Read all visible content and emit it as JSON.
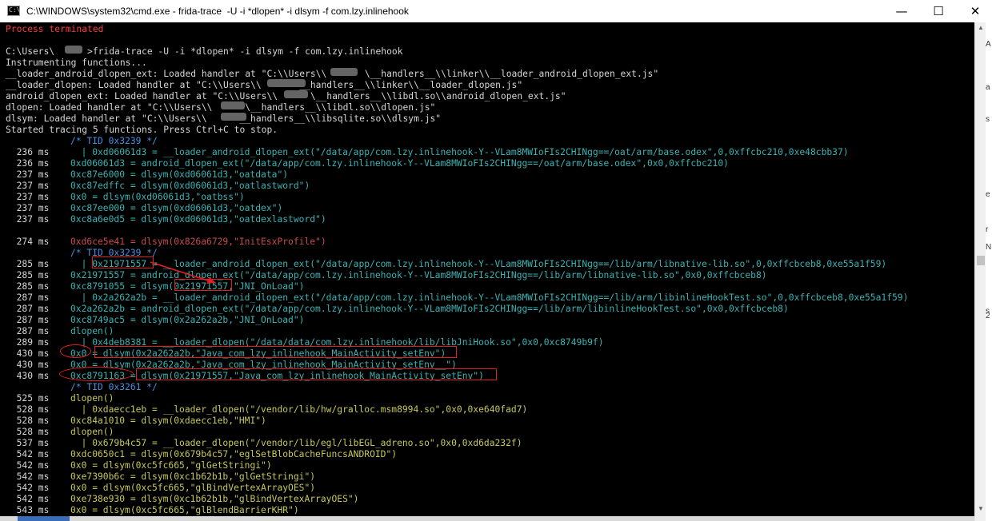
{
  "window": {
    "title": "C:\\WINDOWS\\system32\\cmd.exe - frida-trace  -U -i *dlopen* -i dlsym -f com.lzy.inlinehook",
    "minimize_glyph": "—",
    "maximize_glyph": "☐",
    "close_glyph": "✕",
    "icon_text": "C:\\"
  },
  "colors": {
    "console_bg": "#000000",
    "default_text": "#d6d6d6",
    "process_terminated": "#ff3b3b",
    "tid_comment": "#4a8fe0",
    "trace_pid_3239": "#3ab3b3",
    "trace_pid_325f": "#c94c4c",
    "trace_pid_3261": "#c8c85a",
    "highlight_box": "#e02020"
  },
  "console": {
    "lines": [
      {
        "text": "Process terminated",
        "color": "process_terminated"
      },
      {
        "text": "",
        "color": "default_text"
      },
      {
        "text": "C:\\Users\\      >frida-trace -U -i *dlopen* -i dlsym -f com.lzy.inlinehook",
        "color": "default_text"
      },
      {
        "text": "Instrumenting functions...",
        "color": "default_text"
      },
      {
        "text": "__loader_android_dlopen_ext: Loaded handler at \"C:\\\\Users\\\\       \\__handlers__\\\\linker\\\\__loader_android_dlopen_ext.js\"",
        "color": "default_text"
      },
      {
        "text": "__loader_dlopen: Loaded handler at \"C:\\\\Users\\\\       __handlers__\\\\linker\\\\__loader_dlopen.js\"",
        "color": "default_text"
      },
      {
        "text": "android_dlopen_ext: Loaded handler at \"C:\\\\Users\\\\      \\__handlers__\\\\libdl.so\\\\android_dlopen_ext.js\"",
        "color": "default_text"
      },
      {
        "text": "dlopen: Loaded handler at \"C:\\\\Users\\\\      \\__handlers__\\\\libdl.so\\\\dlopen.js\"",
        "color": "default_text"
      },
      {
        "text": "dlsym: Loaded handler at \"C:\\\\Users\\\\      __handlers__\\\\libsqlite.so\\\\dlsym.js\"",
        "color": "default_text"
      },
      {
        "text": "Started tracing 5 functions. Press Ctrl+C to stop.",
        "color": "default_text"
      },
      {
        "ms": "",
        "text": "/* TID 0x3239 */",
        "color": "tid_comment"
      },
      {
        "ms": "236 ms",
        "text": "  | 0xd06061d3 = __loader_android_dlopen_ext(\"/data/app/com.lzy.inlinehook-Y--VLam8MWIoFIs2CHINgg==/oat/arm/base.odex\",0,0xffcbc210,0xe48cbb37)",
        "color": "trace_pid_3239"
      },
      {
        "ms": "236 ms",
        "text": "0xd06061d3 = android_dlopen_ext(\"/data/app/com.lzy.inlinehook-Y--VLam8MWIoFIs2CHINgg==/oat/arm/base.odex\",0x0,0xffcbc210)",
        "color": "trace_pid_3239"
      },
      {
        "ms": "237 ms",
        "text": "0xc87e6000 = dlsym(0xd06061d3,\"oatdata\")",
        "color": "trace_pid_3239"
      },
      {
        "ms": "237 ms",
        "text": "0xc87edffc = dlsym(0xd06061d3,\"oatlastword\")",
        "color": "trace_pid_3239"
      },
      {
        "ms": "237 ms",
        "text": "0x0 = dlsym(0xd06061d3,\"oatbss\")",
        "color": "trace_pid_3239"
      },
      {
        "ms": "237 ms",
        "text": "0xc87ee000 = dlsym(0xd06061d3,\"oatdex\")",
        "color": "trace_pid_3239"
      },
      {
        "ms": "237 ms",
        "text": "0xc8a6e0d5 = dlsym(0xd06061d3,\"oatdexlastword\")",
        "color": "trace_pid_3239"
      },
      {
        "ms": "",
        "text": "",
        "color": "default_text"
      },
      {
        "ms": "274 ms",
        "text": "0xd6ce5e41 = dlsym(0x826a6729,\"InitEsxProfile\")",
        "color": "trace_pid_325f"
      },
      {
        "ms": "",
        "text": "/* TID 0x3239 */",
        "color": "tid_comment"
      },
      {
        "ms": "285 ms",
        "text": "  | 0x21971557 = __loader_android_dlopen_ext(\"/data/app/com.lzy.inlinehook-Y--VLam8MWIoFIs2CHINgg==/lib/arm/libnative-lib.so\",0,0xffcbceb8,0xe55a1f59)",
        "color": "trace_pid_3239"
      },
      {
        "ms": "285 ms",
        "text": "0x21971557 = android_dlopen_ext(\"/data/app/com.lzy.inlinehook-Y--VLam8MWIoFIs2CHINgg==/lib/arm/libnative-lib.so\",0x0,0xffcbceb8)",
        "color": "trace_pid_3239"
      },
      {
        "ms": "285 ms",
        "text": "0xc8791055 = dlsym(0x21971557,\"JNI_OnLoad\")",
        "color": "trace_pid_3239"
      },
      {
        "ms": "287 ms",
        "text": "  | 0x2a262a2b = __loader_android_dlopen_ext(\"/data/app/com.lzy.inlinehook-Y--VLam8MWIoFIs2CHINgg==/lib/arm/libinlineHookTest.so\",0,0xffcbceb8,0xe55a1f59)",
        "color": "trace_pid_3239"
      },
      {
        "ms": "287 ms",
        "text": "0x2a262a2b = android_dlopen_ext(\"/data/app/com.lzy.inlinehook-Y--VLam8MWIoFIs2CHINgg==/lib/arm/libinlineHookTest.so\",0x0,0xffcbceb8)",
        "color": "trace_pid_3239"
      },
      {
        "ms": "287 ms",
        "text": "0xc8749ac5 = dlsym(0x2a262a2b,\"JNI_OnLoad\")",
        "color": "trace_pid_3239"
      },
      {
        "ms": "287 ms",
        "text": "dlopen()",
        "color": "trace_pid_3239"
      },
      {
        "ms": "289 ms",
        "text": "  | 0x4deb8381 = __loader_dlopen(\"/data/data/com.lzy.inlinehook/lib/libJniHook.so\",0x0,0xc8749b9f)",
        "color": "trace_pid_3239"
      },
      {
        "ms": "430 ms",
        "text": "0x0 = dlsym(0x2a262a2b,\"Java_com_lzy_inlinehook_MainActivity_setEnv\")",
        "color": "trace_pid_3239"
      },
      {
        "ms": "430 ms",
        "text": "0x0 = dlsym(0x2a262a2b,\"Java_com_lzy_inlinehook_MainActivity_setEnv__\")",
        "color": "trace_pid_3239"
      },
      {
        "ms": "430 ms",
        "text": "0xc8791163 = dlsym(0x21971557,\"Java_com_lzy_inlinehook_MainActivity_setEnv\")",
        "color": "trace_pid_3239"
      },
      {
        "ms": "",
        "text": "/* TID 0x3261 */",
        "color": "tid_comment"
      },
      {
        "ms": "525 ms",
        "text": "dlopen()",
        "color": "trace_pid_3261"
      },
      {
        "ms": "528 ms",
        "text": "  | 0xdaecc1eb = __loader_dlopen(\"/vendor/lib/hw/gralloc.msm8994.so\",0x0,0xe640fad7)",
        "color": "trace_pid_3261"
      },
      {
        "ms": "528 ms",
        "text": "0xc84a1010 = dlsym(0xdaecc1eb,\"HMI\")",
        "color": "trace_pid_3261"
      },
      {
        "ms": "528 ms",
        "text": "dlopen()",
        "color": "trace_pid_3261"
      },
      {
        "ms": "537 ms",
        "text": "  | 0x679b4c57 = __loader_dlopen(\"/vendor/lib/egl/libEGL_adreno.so\",0x0,0xd6da232f)",
        "color": "trace_pid_3261"
      },
      {
        "ms": "542 ms",
        "text": "0xdc0650c1 = dlsym(0x679b4c57,\"eglSetBlobCacheFuncsANDROID\")",
        "color": "trace_pid_3261"
      },
      {
        "ms": "542 ms",
        "text": "0x0 = dlsym(0xc5fc665,\"glGetStringi\")",
        "color": "trace_pid_3261"
      },
      {
        "ms": "542 ms",
        "text": "0xe7390b6c = dlsym(0xc1b62b1b,\"glGetStringi\")",
        "color": "trace_pid_3261"
      },
      {
        "ms": "542 ms",
        "text": "0x0 = dlsym(0xc5fc665,\"glBindVertexArrayOES\")",
        "color": "trace_pid_3261"
      },
      {
        "ms": "542 ms",
        "text": "0xe738e930 = dlsym(0xc1b62b1b,\"glBindVertexArrayOES\")",
        "color": "trace_pid_3261"
      },
      {
        "ms": "543 ms",
        "text": "0x0 = dlsym(0xc5fc665,\"glBlendBarrierKHR\")",
        "color": "trace_pid_3261"
      }
    ]
  },
  "side_panel": {
    "glyphs": [
      "A",
      "a",
      "s",
      "e",
      "r",
      "N",
      "s",
      "2"
    ]
  }
}
